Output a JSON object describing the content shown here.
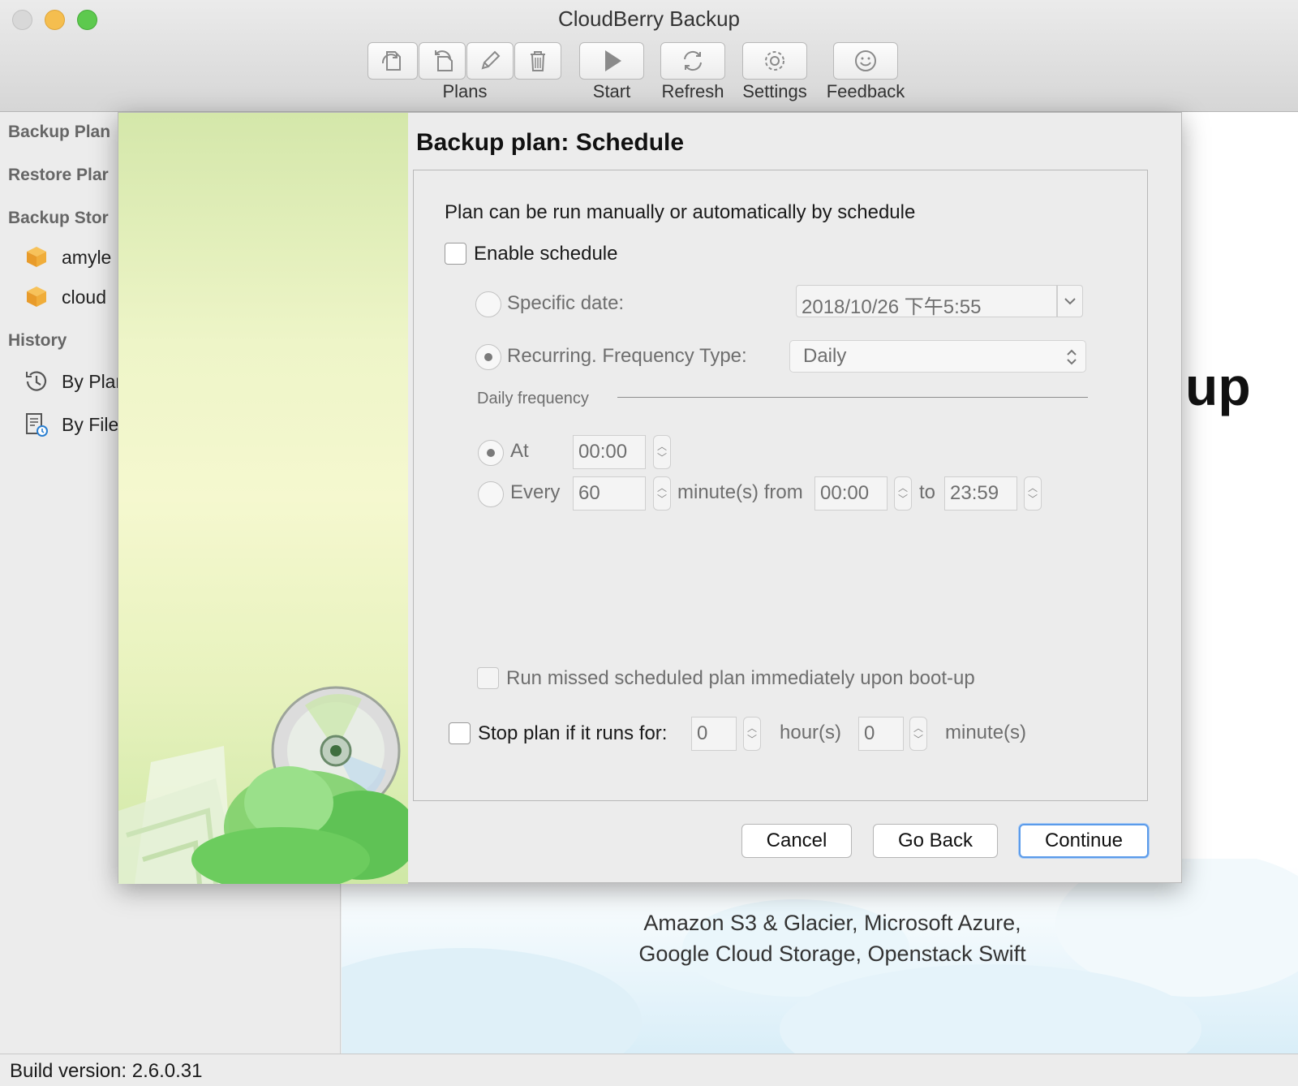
{
  "window": {
    "title": "CloudBerry Backup",
    "traffic_colors": {
      "close": "#d8d8d8",
      "minimize": "#f5be4f",
      "zoom": "#5dc94e"
    }
  },
  "toolbar": {
    "plans_label": "Plans",
    "start_label": "Start",
    "refresh_label": "Refresh",
    "settings_label": "Settings",
    "feedback_label": "Feedback",
    "plan_icons": [
      "backup-plan-icon",
      "restore-plan-icon",
      "edit-icon",
      "trash-icon"
    ]
  },
  "sidebar": {
    "backup_plans": "Backup Plan",
    "restore_plans": "Restore Plar",
    "backup_storage": "Backup Stor",
    "storages": [
      "amyle",
      "cloud"
    ],
    "history": "History",
    "history_items": [
      "By Plar",
      "By File"
    ]
  },
  "main": {
    "brand_partial": "up",
    "providers_line1": "Amazon S3 & Glacier, Microsoft Azure,",
    "providers_line2": "Google Cloud Storage, Openstack Swift"
  },
  "dialog": {
    "title": "Backup plan: Schedule",
    "intro": "Plan can be run manually or automatically by schedule",
    "enable_schedule": {
      "label": "Enable schedule",
      "checked": false
    },
    "specific_date": {
      "label": "Specific date:",
      "value": "2018/10/26 下午5:55",
      "selected": false
    },
    "recurring": {
      "label": "Recurring. Frequency Type:",
      "value": "Daily",
      "selected": true
    },
    "daily_frequency": {
      "section_label": "Daily frequency",
      "at_label": "At",
      "at_value": "00:00",
      "every_label": "Every",
      "every_value": "60",
      "from_label": "minute(s) from",
      "from_value": "00:00",
      "to_label": "to",
      "to_value": "23:59"
    },
    "run_missed": {
      "label": "Run missed scheduled plan immediately upon boot-up",
      "checked": false
    },
    "stop_plan": {
      "label": "Stop plan if it runs for:",
      "hours": "0",
      "hours_label": "hour(s)",
      "minutes": "0",
      "minutes_label": "minute(s)",
      "checked": false
    },
    "buttons": {
      "cancel": "Cancel",
      "go_back": "Go Back",
      "continue": "Continue"
    }
  },
  "status": {
    "build": "Build version: 2.6.0.31"
  }
}
